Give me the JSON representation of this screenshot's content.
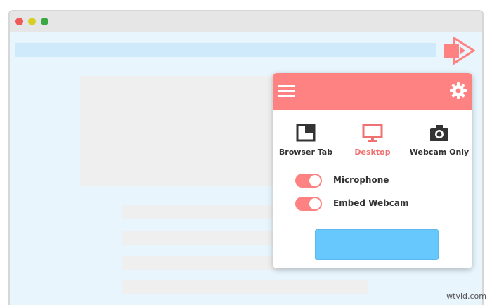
{
  "colors": {
    "accent": "#ff8282",
    "primary_button": "#66c8fc",
    "browser_background": "#e8f5fc",
    "address_bar": "#cfeafb",
    "placeholder": "#efefef"
  },
  "browser": {
    "traffic_lights": [
      "close",
      "minimize",
      "maximize"
    ]
  },
  "extension": {
    "icon": "record-arrow-icon"
  },
  "popup": {
    "header": {
      "menu_icon": "hamburger-menu-icon",
      "settings_icon": "gear-icon"
    },
    "modes": [
      {
        "label": "Browser Tab",
        "icon": "browser-tab-icon",
        "active": false
      },
      {
        "label": "Desktop",
        "icon": "monitor-icon",
        "active": true
      },
      {
        "label": "Webcam Only",
        "icon": "camera-icon",
        "active": false
      }
    ],
    "toggles": [
      {
        "label": "Microphone",
        "on": true
      },
      {
        "label": "Embed Webcam",
        "on": true
      }
    ],
    "start_button_label": ""
  },
  "watermark": "wtvid.com"
}
